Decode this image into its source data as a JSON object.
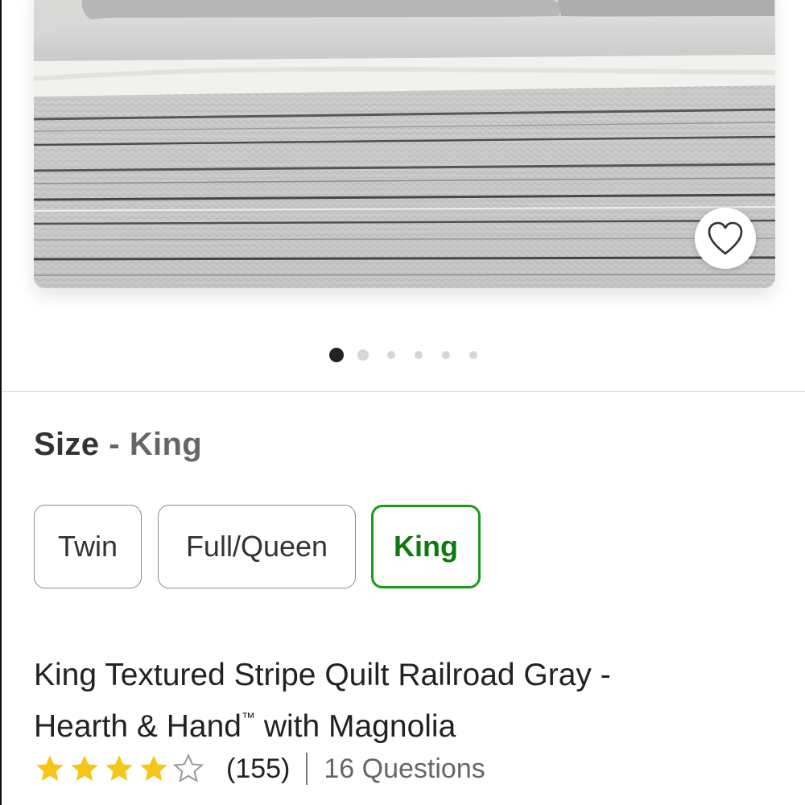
{
  "product_image": {
    "alt": "King Textured Stripe Quilt Railroad Gray"
  },
  "favorite": {
    "icon": "heart-outline-icon"
  },
  "carousel": {
    "total": 6,
    "active_index": 0
  },
  "size": {
    "label": "Size",
    "separator": "-",
    "selected_value": "King",
    "options": [
      {
        "label": "Twin",
        "selected": false
      },
      {
        "label": "Full/Queen",
        "selected": false
      },
      {
        "label": "King",
        "selected": true
      }
    ]
  },
  "product": {
    "title_line1": "King Textured Stripe Quilt Railroad Gray -",
    "title_line2_prefix": "Hearth & Hand",
    "title_tm": "™",
    "title_line2_suffix": " with Magnolia"
  },
  "rating": {
    "stars": 4,
    "max_stars": 5,
    "review_count": "(155)",
    "questions": "16 Questions"
  },
  "colors": {
    "selected_border": "#1c9a1c",
    "selected_text": "#0e7a0e",
    "star_fill": "#f5c518",
    "active_dot": "#222222",
    "inactive_dot": "#d6d6d6"
  }
}
